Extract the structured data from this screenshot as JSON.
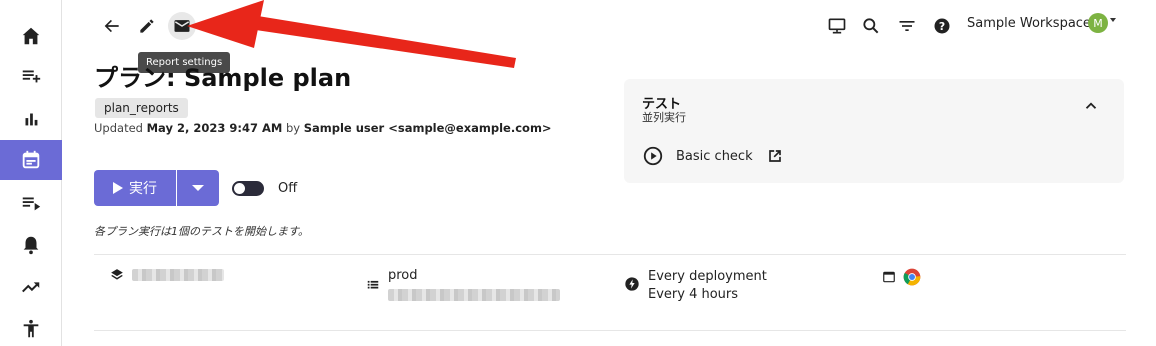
{
  "toolbar": {
    "back_icon": "arrow-left-icon",
    "edit_icon": "pencil-icon",
    "mail_icon": "mail-icon",
    "copy_icon": "copy-icon",
    "delete_icon": "trash-icon",
    "terminal_icon": "terminal-icon",
    "tooltip": "Report settings"
  },
  "topright": {
    "workspace": "Sample Workspace",
    "avatar_letter": "M"
  },
  "plan": {
    "title": "プラン: Sample plan",
    "tag": "plan_reports",
    "updated_prefix": "Updated",
    "updated_date": "May 2, 2023 9:47 AM",
    "updated_by": "by",
    "updated_user": "Sample user <sample@example.com>",
    "run_label": "実行",
    "toggle_label": "Off",
    "description": "各プラン実行は1個のテストを開始します。"
  },
  "card": {
    "title": "テスト",
    "subtitle": "並列実行",
    "item_label": "Basic check"
  },
  "details": {
    "environment": "prod",
    "schedule_line1": "Every deployment",
    "schedule_line2": "Every 4 hours"
  },
  "colors": {
    "accent": "#6b6bd6",
    "arrow": "#e8261a",
    "avatar": "#7db342"
  }
}
